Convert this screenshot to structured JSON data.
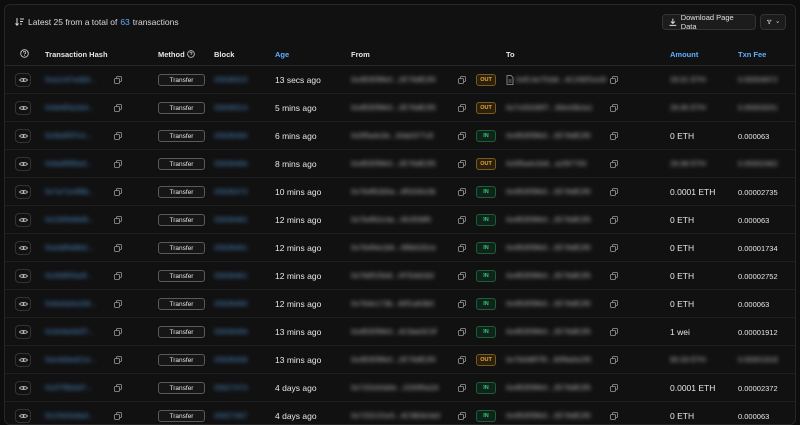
{
  "summary": {
    "prefix": "Latest 25 from a total of",
    "total": "63",
    "suffix": "transactions"
  },
  "toolbar": {
    "download_label": "Download Page Data"
  },
  "columns": {
    "hash": "Transaction Hash",
    "method": "Method",
    "block": "Block",
    "age": "Age",
    "from": "From",
    "to": "To",
    "amount": "Amount",
    "fee": "Txn Fee"
  },
  "colors": {
    "accent": "#5fb0ff",
    "out": "#e8a93a",
    "in": "#39c57b"
  },
  "rows": [
    {
      "hash": "0xa1c97a3b5...",
      "method": "Transfer",
      "block": "20636523",
      "age": "13 secs ago",
      "from": "0x4fDEf9fe0...2E76dE2f0",
      "dir": "OUT",
      "to": "0xfC4e7f1b8...4C25Ef1e26",
      "to_contract": true,
      "amount": "29.91 ETH",
      "amount_blurred": true,
      "fee": "0.00004972",
      "fee_blurred": true
    },
    {
      "hash": "0x9e6f3a1b4...",
      "method": "Transfer",
      "block": "20636514",
      "age": "5 mins ago",
      "from": "0x4fDEf9fe0...2E76dE2f0",
      "dir": "OUT",
      "to": "0x7c002d5f7...90e43b2a1",
      "to_contract": false,
      "amount": "29.95 ETH",
      "amount_blurred": true,
      "fee": "0.00003201",
      "fee_blurred": true
    },
    {
      "hash": "0x3b4f0f7e1...",
      "method": "Transfer",
      "block": "20636494",
      "age": "6 mins ago",
      "from": "0x5f5a4c0e...93a0377c8",
      "dir": "IN",
      "to": "0x4fDEf9fe0...2E76dE2f0",
      "to_contract": false,
      "amount": "0 ETH",
      "amount_blurred": false,
      "fee": "0.000063",
      "fee_blurred": false
    },
    {
      "hash": "0x8a9f9f9a3...",
      "method": "Transfer",
      "block": "20636484",
      "age": "8 mins ago",
      "from": "0x4fDEf9fe0...2E76dE2f0",
      "dir": "OUT",
      "to": "0x5f5a4c0e8...a1f97700",
      "to_contract": false,
      "amount": "29.98 ETH",
      "amount_blurred": true,
      "fee": "0.00002462",
      "fee_blurred": true
    },
    {
      "hash": "0x7a71e4f8b...",
      "method": "Transfer",
      "block": "20636473",
      "age": "10 mins ago",
      "from": "0x7b4f62b5a...6f5330c0b",
      "dir": "IN",
      "to": "0x4fDEf9fe0...2E76dE2f0",
      "to_contract": false,
      "amount": "0.0001 ETH",
      "amount_blurred": false,
      "fee": "0.00002735",
      "fee_blurred": false
    },
    {
      "hash": "0x150f4d0d5...",
      "method": "Transfer",
      "block": "20636462",
      "age": "12 mins ago",
      "from": "0x7b4f62c4a...0fc5f39f0",
      "dir": "IN",
      "to": "0x4fDEf9fe0...2E76dE2f0",
      "to_contract": false,
      "amount": "0 ETH",
      "amount_blurred": false,
      "fee": "0.000063",
      "fee_blurred": false
    },
    {
      "hash": "0xa3df4d8d1...",
      "method": "Transfer",
      "block": "20636461",
      "age": "12 mins ago",
      "from": "0x7b4f4e1b6...0f6b02b1e",
      "dir": "IN",
      "to": "0x4fDEf9fe0...2E76dE2f0",
      "to_contract": false,
      "amount": "0 ETH",
      "amount_blurred": false,
      "fee": "0.00001734",
      "fee_blurred": false
    },
    {
      "hash": "0x2b9f05a3f...",
      "method": "Transfer",
      "block": "20636461",
      "age": "12 mins ago",
      "from": "0x7b9f1f3e8...0f7b3d1b0",
      "dir": "IN",
      "to": "0x4fDEf9fe0...2E76dE2f0",
      "to_contract": false,
      "amount": "0 ETH",
      "amount_blurred": false,
      "fee": "0.00002752",
      "fee_blurred": false
    },
    {
      "hash": "0x9a4a0a1b9...",
      "method": "Transfer",
      "block": "20636460",
      "age": "12 mins ago",
      "from": "0x7b4e173b...80f1a63b0",
      "dir": "IN",
      "to": "0x4fDEf9fe0...2E76dE2f0",
      "to_contract": false,
      "amount": "0 ETH",
      "amount_blurred": false,
      "fee": "0.000063",
      "fee_blurred": false
    },
    {
      "hash": "0x3e9a0d2f7...",
      "method": "Transfer",
      "block": "20636409",
      "age": "13 mins ago",
      "from": "0x4fDEf9fe0...4C9ae0C0f",
      "dir": "IN",
      "to": "0x4fDEf9fe0...2E76dE2f0",
      "to_contract": false,
      "amount": "1 wei",
      "amount_blurred": false,
      "fee": "0.00001912",
      "fee_blurred": false
    },
    {
      "hash": "0xe4d3ed21e...",
      "method": "Transfer",
      "block": "20636408",
      "age": "13 mins ago",
      "from": "0x4fDEf9fe0...2E76dE2f0",
      "dir": "OUT",
      "to": "0x7b0d8f7f0...90f9a0e2f0",
      "to_contract": false,
      "amount": "90.09 ETH",
      "amount_blurred": true,
      "fee": "0.00001918",
      "fee_blurred": true
    },
    {
      "hash": "0x2f7f6b4d7...",
      "method": "Transfer",
      "block": "20627473",
      "age": "4 days ago",
      "from": "0x7202e0a0e...2330f0a2d",
      "dir": "IN",
      "to": "0x4fDEf9fe0...2E76dE2f0",
      "to_contract": false,
      "amount": "0.0001 ETH",
      "amount_blurred": false,
      "fee": "0.00002372",
      "fee_blurred": false
    },
    {
      "hash": "0x1f3e5e8a4...",
      "method": "Transfer",
      "block": "20627467",
      "age": "4 days ago",
      "from": "0x72021f1e0...4C9B3e3a0",
      "dir": "IN",
      "to": "0x4fDEf9fe0...2E76dE2f0",
      "to_contract": false,
      "amount": "0 ETH",
      "amount_blurred": false,
      "fee": "0.000063",
      "fee_blurred": false
    }
  ]
}
